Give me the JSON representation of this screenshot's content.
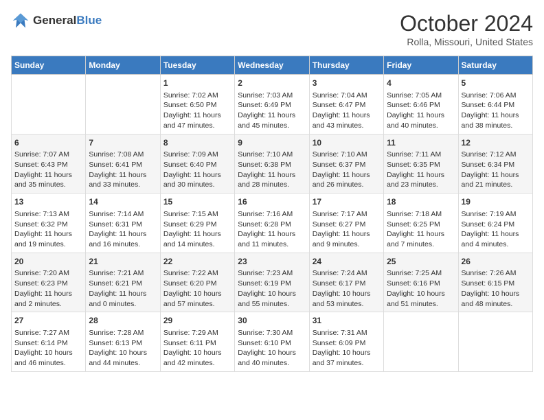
{
  "logo": {
    "line1": "General",
    "line2": "Blue"
  },
  "title": "October 2024",
  "location": "Rolla, Missouri, United States",
  "weekdays": [
    "Sunday",
    "Monday",
    "Tuesday",
    "Wednesday",
    "Thursday",
    "Friday",
    "Saturday"
  ],
  "weeks": [
    [
      {
        "day": "",
        "sunrise": "",
        "sunset": "",
        "daylight": ""
      },
      {
        "day": "",
        "sunrise": "",
        "sunset": "",
        "daylight": ""
      },
      {
        "day": "1",
        "sunrise": "Sunrise: 7:02 AM",
        "sunset": "Sunset: 6:50 PM",
        "daylight": "Daylight: 11 hours and 47 minutes."
      },
      {
        "day": "2",
        "sunrise": "Sunrise: 7:03 AM",
        "sunset": "Sunset: 6:49 PM",
        "daylight": "Daylight: 11 hours and 45 minutes."
      },
      {
        "day": "3",
        "sunrise": "Sunrise: 7:04 AM",
        "sunset": "Sunset: 6:47 PM",
        "daylight": "Daylight: 11 hours and 43 minutes."
      },
      {
        "day": "4",
        "sunrise": "Sunrise: 7:05 AM",
        "sunset": "Sunset: 6:46 PM",
        "daylight": "Daylight: 11 hours and 40 minutes."
      },
      {
        "day": "5",
        "sunrise": "Sunrise: 7:06 AM",
        "sunset": "Sunset: 6:44 PM",
        "daylight": "Daylight: 11 hours and 38 minutes."
      }
    ],
    [
      {
        "day": "6",
        "sunrise": "Sunrise: 7:07 AM",
        "sunset": "Sunset: 6:43 PM",
        "daylight": "Daylight: 11 hours and 35 minutes."
      },
      {
        "day": "7",
        "sunrise": "Sunrise: 7:08 AM",
        "sunset": "Sunset: 6:41 PM",
        "daylight": "Daylight: 11 hours and 33 minutes."
      },
      {
        "day": "8",
        "sunrise": "Sunrise: 7:09 AM",
        "sunset": "Sunset: 6:40 PM",
        "daylight": "Daylight: 11 hours and 30 minutes."
      },
      {
        "day": "9",
        "sunrise": "Sunrise: 7:10 AM",
        "sunset": "Sunset: 6:38 PM",
        "daylight": "Daylight: 11 hours and 28 minutes."
      },
      {
        "day": "10",
        "sunrise": "Sunrise: 7:10 AM",
        "sunset": "Sunset: 6:37 PM",
        "daylight": "Daylight: 11 hours and 26 minutes."
      },
      {
        "day": "11",
        "sunrise": "Sunrise: 7:11 AM",
        "sunset": "Sunset: 6:35 PM",
        "daylight": "Daylight: 11 hours and 23 minutes."
      },
      {
        "day": "12",
        "sunrise": "Sunrise: 7:12 AM",
        "sunset": "Sunset: 6:34 PM",
        "daylight": "Daylight: 11 hours and 21 minutes."
      }
    ],
    [
      {
        "day": "13",
        "sunrise": "Sunrise: 7:13 AM",
        "sunset": "Sunset: 6:32 PM",
        "daylight": "Daylight: 11 hours and 19 minutes."
      },
      {
        "day": "14",
        "sunrise": "Sunrise: 7:14 AM",
        "sunset": "Sunset: 6:31 PM",
        "daylight": "Daylight: 11 hours and 16 minutes."
      },
      {
        "day": "15",
        "sunrise": "Sunrise: 7:15 AM",
        "sunset": "Sunset: 6:29 PM",
        "daylight": "Daylight: 11 hours and 14 minutes."
      },
      {
        "day": "16",
        "sunrise": "Sunrise: 7:16 AM",
        "sunset": "Sunset: 6:28 PM",
        "daylight": "Daylight: 11 hours and 11 minutes."
      },
      {
        "day": "17",
        "sunrise": "Sunrise: 7:17 AM",
        "sunset": "Sunset: 6:27 PM",
        "daylight": "Daylight: 11 hours and 9 minutes."
      },
      {
        "day": "18",
        "sunrise": "Sunrise: 7:18 AM",
        "sunset": "Sunset: 6:25 PM",
        "daylight": "Daylight: 11 hours and 7 minutes."
      },
      {
        "day": "19",
        "sunrise": "Sunrise: 7:19 AM",
        "sunset": "Sunset: 6:24 PM",
        "daylight": "Daylight: 11 hours and 4 minutes."
      }
    ],
    [
      {
        "day": "20",
        "sunrise": "Sunrise: 7:20 AM",
        "sunset": "Sunset: 6:23 PM",
        "daylight": "Daylight: 11 hours and 2 minutes."
      },
      {
        "day": "21",
        "sunrise": "Sunrise: 7:21 AM",
        "sunset": "Sunset: 6:21 PM",
        "daylight": "Daylight: 11 hours and 0 minutes."
      },
      {
        "day": "22",
        "sunrise": "Sunrise: 7:22 AM",
        "sunset": "Sunset: 6:20 PM",
        "daylight": "Daylight: 10 hours and 57 minutes."
      },
      {
        "day": "23",
        "sunrise": "Sunrise: 7:23 AM",
        "sunset": "Sunset: 6:19 PM",
        "daylight": "Daylight: 10 hours and 55 minutes."
      },
      {
        "day": "24",
        "sunrise": "Sunrise: 7:24 AM",
        "sunset": "Sunset: 6:17 PM",
        "daylight": "Daylight: 10 hours and 53 minutes."
      },
      {
        "day": "25",
        "sunrise": "Sunrise: 7:25 AM",
        "sunset": "Sunset: 6:16 PM",
        "daylight": "Daylight: 10 hours and 51 minutes."
      },
      {
        "day": "26",
        "sunrise": "Sunrise: 7:26 AM",
        "sunset": "Sunset: 6:15 PM",
        "daylight": "Daylight: 10 hours and 48 minutes."
      }
    ],
    [
      {
        "day": "27",
        "sunrise": "Sunrise: 7:27 AM",
        "sunset": "Sunset: 6:14 PM",
        "daylight": "Daylight: 10 hours and 46 minutes."
      },
      {
        "day": "28",
        "sunrise": "Sunrise: 7:28 AM",
        "sunset": "Sunset: 6:13 PM",
        "daylight": "Daylight: 10 hours and 44 minutes."
      },
      {
        "day": "29",
        "sunrise": "Sunrise: 7:29 AM",
        "sunset": "Sunset: 6:11 PM",
        "daylight": "Daylight: 10 hours and 42 minutes."
      },
      {
        "day": "30",
        "sunrise": "Sunrise: 7:30 AM",
        "sunset": "Sunset: 6:10 PM",
        "daylight": "Daylight: 10 hours and 40 minutes."
      },
      {
        "day": "31",
        "sunrise": "Sunrise: 7:31 AM",
        "sunset": "Sunset: 6:09 PM",
        "daylight": "Daylight: 10 hours and 37 minutes."
      },
      {
        "day": "",
        "sunrise": "",
        "sunset": "",
        "daylight": ""
      },
      {
        "day": "",
        "sunrise": "",
        "sunset": "",
        "daylight": ""
      }
    ]
  ]
}
